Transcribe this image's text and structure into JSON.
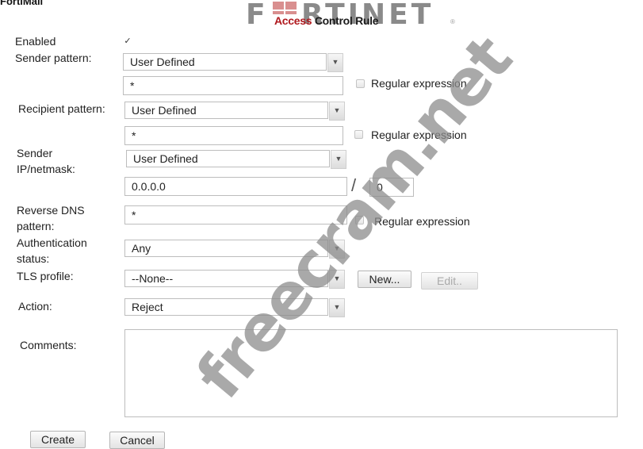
{
  "app": {
    "title": "FortiMail",
    "brand": "FORTINET"
  },
  "dialog": {
    "title_accent": "Access",
    "title_rest": " Control Rule"
  },
  "colors": {
    "brand_red": "#b0191e",
    "logo_gray": "#8a8a8a"
  },
  "form": {
    "enabled": {
      "label": "Enabled",
      "checked": true,
      "glyph": "✓"
    },
    "sender_pattern": {
      "label": "Sender pattern:",
      "type_value": "User Defined",
      "value": "*",
      "regex_label": "Regular expression",
      "regex_checked": false
    },
    "recipient_pattern": {
      "label": "Recipient pattern:",
      "type_value": "User Defined",
      "value": "*",
      "regex_label": "Regular expression",
      "regex_checked": false
    },
    "sender_ip": {
      "label_line1": "Sender",
      "label_line2": "IP/netmask:",
      "type_value": "User Defined",
      "ip": "0.0.0.0",
      "separator": "/",
      "mask": "0"
    },
    "reverse_dns": {
      "label_line1": "Reverse DNS",
      "label_line2": "pattern:",
      "value": "*",
      "regex_label": "Regular expression",
      "regex_checked": false
    },
    "auth_status": {
      "label_line1": "Authentication",
      "label_line2": "status:",
      "value": "Any"
    },
    "tls_profile": {
      "label": "TLS profile:",
      "value": "--None--",
      "new_label": "New...",
      "edit_label": "Edit.."
    },
    "action": {
      "label": "Action:",
      "value": "Reject"
    },
    "comments": {
      "label": "Comments:",
      "value": ""
    }
  },
  "buttons": {
    "create": "Create",
    "cancel": "Cancel"
  },
  "watermark": "freecram.net"
}
